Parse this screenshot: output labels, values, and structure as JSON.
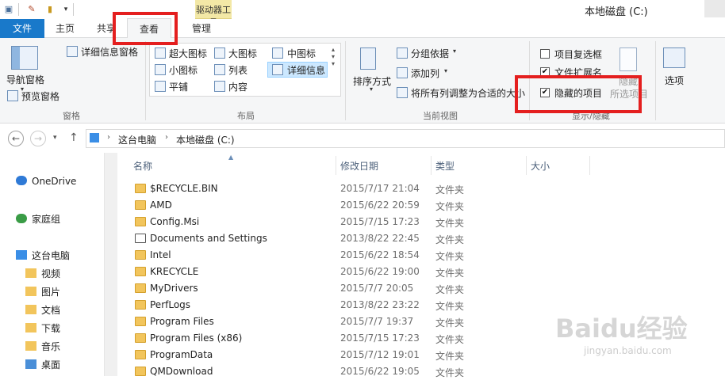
{
  "titlebar": {
    "title": "本地磁盘 (C:)",
    "context_tab": "驱动器工具"
  },
  "tabs": {
    "file": "文件",
    "home": "主页",
    "share": "共享",
    "view": "查看",
    "manage": "管理"
  },
  "ribbon": {
    "panes": {
      "nav_pane": "导航窗格",
      "preview_pane": "预览窗格",
      "details_pane": "详细信息窗格",
      "label": "窗格"
    },
    "layout": {
      "extra_large": "超大图标",
      "large": "大图标",
      "medium": "中图标",
      "small": "小图标",
      "list": "列表",
      "details": "详细信息",
      "tiles": "平铺",
      "content": "内容",
      "label": "布局"
    },
    "current_view": {
      "sort_by": "排序方式",
      "group_by": "分组依据",
      "add_columns": "添加列",
      "size_all_columns": "将所有列调整为合适的大小",
      "label": "当前视图"
    },
    "show_hide": {
      "item_checkboxes": "项目复选框",
      "file_extensions": "文件扩展名",
      "hidden_items": "隐藏的项目",
      "hide_selected_1": "隐藏",
      "hide_selected_2": "所选项目",
      "label": "显示/隐藏",
      "item_checkboxes_checked": false,
      "file_extensions_checked": true,
      "hidden_items_checked": true
    },
    "options": "选项"
  },
  "address": {
    "this_pc": "这台电脑",
    "drive": "本地磁盘 (C:)"
  },
  "nav": {
    "onedrive": "OneDrive",
    "homegroup": "家庭组",
    "this_pc": "这台电脑",
    "items": [
      "视频",
      "图片",
      "文档",
      "下载",
      "音乐",
      "桌面"
    ]
  },
  "columns": {
    "name": "名称",
    "modified": "修改日期",
    "type": "类型",
    "size": "大小"
  },
  "files": [
    {
      "name": "$RECYCLE.BIN",
      "date": "2015/7/17 21:04",
      "type": "文件夹"
    },
    {
      "name": "AMD",
      "date": "2015/6/22 20:59",
      "type": "文件夹"
    },
    {
      "name": "Config.Msi",
      "date": "2015/7/15 17:23",
      "type": "文件夹"
    },
    {
      "name": "Documents and Settings",
      "date": "2013/8/22 22:45",
      "type": "文件夹"
    },
    {
      "name": "Intel",
      "date": "2015/6/22 18:54",
      "type": "文件夹"
    },
    {
      "name": "KRECYCLE",
      "date": "2015/6/22 19:00",
      "type": "文件夹"
    },
    {
      "name": "MyDrivers",
      "date": "2015/7/7 20:05",
      "type": "文件夹"
    },
    {
      "name": "PerfLogs",
      "date": "2013/8/22 23:22",
      "type": "文件夹"
    },
    {
      "name": "Program Files",
      "date": "2015/7/7 19:37",
      "type": "文件夹"
    },
    {
      "name": "Program Files (x86)",
      "date": "2015/7/15 17:23",
      "type": "文件夹"
    },
    {
      "name": "ProgramData",
      "date": "2015/7/12 19:01",
      "type": "文件夹"
    },
    {
      "name": "QMDownload",
      "date": "2015/6/22 19:05",
      "type": "文件夹"
    }
  ],
  "watermark": {
    "brand": "Baidu经验",
    "url": "jingyan.baidu.com"
  }
}
